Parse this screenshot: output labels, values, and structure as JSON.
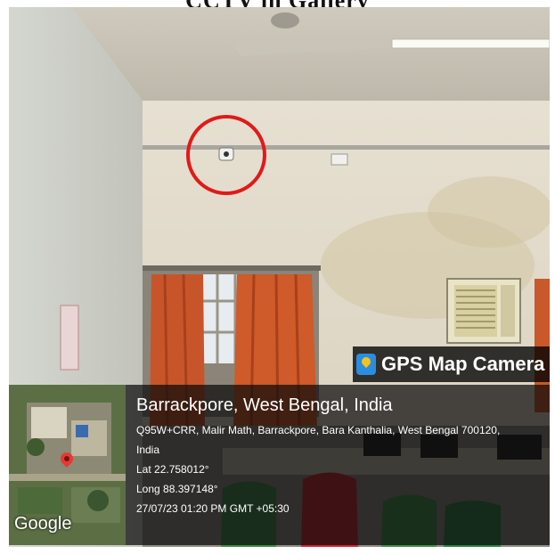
{
  "page": {
    "title": "CCTV in Gallery"
  },
  "overlay": {
    "app_label": "GPS Map Camera",
    "location_title": "Barrackpore, West Bengal, India",
    "address_line1": "Q95W+CRR, Malir Math, Barrackpore, Bara Kanthalia, West Bengal 700120,",
    "address_line2": "India",
    "lat": "Lat 22.758012°",
    "long": "Long 88.397148°",
    "datetime": "27/07/23 01:20 PM GMT +05:30",
    "map_brand": "Google"
  },
  "scene": {
    "marker_color": "#e01a1a",
    "wall_color": "#e4ddd0",
    "curtain_color": "#cf5a2a"
  }
}
